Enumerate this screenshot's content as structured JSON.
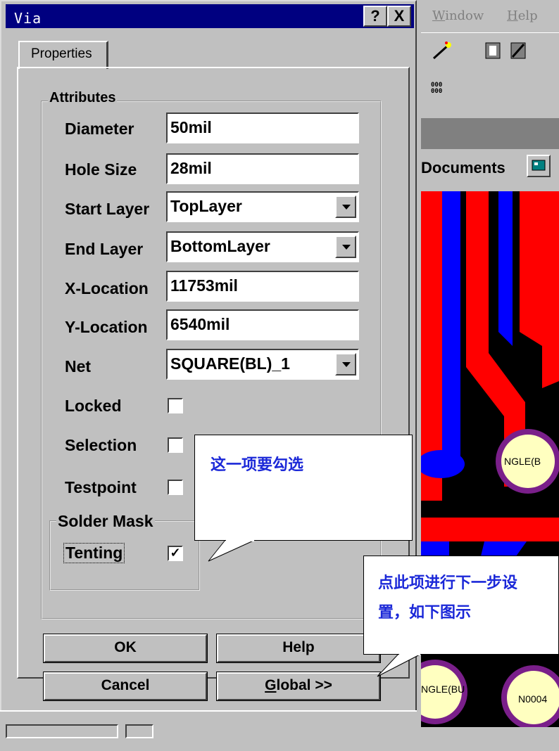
{
  "dialog": {
    "title": "Via",
    "help_button": "?",
    "close_button": "X",
    "tab_label": "Properties",
    "group_title": "Attributes",
    "fields": {
      "diameter": {
        "label": "Diameter",
        "value": "50mil"
      },
      "hole_size": {
        "label": "Hole Size",
        "value": "28mil"
      },
      "start_layer": {
        "label": "Start Layer",
        "value": "TopLayer"
      },
      "end_layer": {
        "label": "End Layer",
        "value": "BottomLayer"
      },
      "x_location": {
        "label": "X-Location",
        "value": "11753mil"
      },
      "y_location": {
        "label": "Y-Location",
        "value": "6540mil"
      },
      "net": {
        "label": "Net",
        "value": "SQUARE(BL)_1"
      }
    },
    "checkboxes": {
      "locked": {
        "label": "Locked",
        "checked": false
      },
      "selection": {
        "label": "Selection",
        "checked": false
      },
      "testpoint": {
        "label": "Testpoint",
        "checked": false
      },
      "tenting": {
        "label": "Tenting",
        "checked": true,
        "mark": "✓"
      }
    },
    "solder_mask_title": "Solder Mask",
    "buttons": {
      "ok": "OK",
      "help": "Help",
      "cancel": "Cancel",
      "global_prefix": "G",
      "global_rest": "lobal >>"
    }
  },
  "app": {
    "menu": {
      "window_prefix": "W",
      "window_rest": "indow",
      "help_prefix": "H",
      "help_rest": "elp"
    },
    "tab_documents": "Documents",
    "pcb_labels": {
      "pad1": "NGLE(B",
      "pad2": "NGLE(BU",
      "pad3": "N0004"
    },
    "toolbar_glyph": "000"
  },
  "callouts": {
    "first": "这一项要勾选",
    "second_line1": "点此项进行下一步设",
    "second_line2": "置，如下图示"
  },
  "colors": {
    "title_bar": "#000080",
    "trace_red": "#ff0000",
    "trace_blue": "#0000ff",
    "pad_ring": "#7a1f8a",
    "callout_text": "#1b28d8"
  }
}
